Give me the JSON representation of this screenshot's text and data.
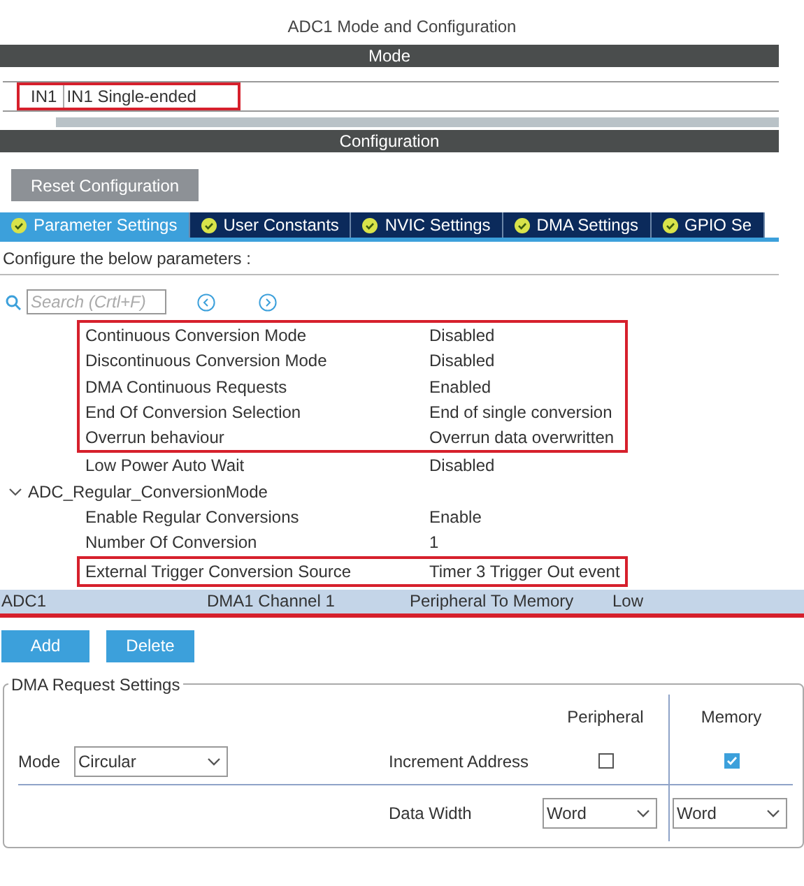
{
  "title": "ADC1 Mode and Configuration",
  "mode_header": "Mode",
  "mode": {
    "channel": "IN1",
    "value": "IN1 Single-ended",
    "highlighted": true
  },
  "config_header": "Configuration",
  "reset_button": "Reset Configuration",
  "tabs": [
    {
      "label": "Parameter Settings",
      "selected": true
    },
    {
      "label": "User Constants",
      "selected": false
    },
    {
      "label": "NVIC Settings",
      "selected": false
    },
    {
      "label": "DMA Settings",
      "selected": false
    },
    {
      "label": "GPIO Se",
      "selected": false
    }
  ],
  "hint": "Configure the below parameters :",
  "search": {
    "placeholder": "Search (Crtl+F)"
  },
  "parameters": [
    {
      "label": "Continuous Conversion Mode",
      "value": "Disabled",
      "highlighted": true
    },
    {
      "label": "Discontinuous Conversion Mode",
      "value": "Disabled",
      "highlighted": true
    },
    {
      "label": "DMA Continuous Requests",
      "value": "Enabled",
      "highlighted": true
    },
    {
      "label": "End Of Conversion Selection",
      "value": "End of single conversion",
      "highlighted": true
    },
    {
      "label": "Overrun behaviour",
      "value": "Overrun data overwritten",
      "highlighted": true
    },
    {
      "label": "Low Power Auto Wait",
      "value": "Disabled",
      "highlighted": false
    },
    {
      "label": "ADC_Regular_ConversionMode",
      "expanded": true,
      "children": [
        {
          "label": "Enable Regular Conversions",
          "value": "Enable",
          "highlighted": false
        },
        {
          "label": "Number Of Conversion",
          "value": "1",
          "highlighted": false
        },
        {
          "label": "External Trigger Conversion Source",
          "value": "Timer 3 Trigger Out event",
          "highlighted": true
        }
      ]
    }
  ],
  "dma_table": {
    "rows": [
      {
        "cells": [
          "ADC1",
          "DMA1 Channel 1",
          "Peripheral To Memory",
          "Low"
        ],
        "selected": true,
        "highlighted": true
      }
    ]
  },
  "dma_buttons": [
    "Add",
    "Delete"
  ],
  "dma_request": {
    "legend": "DMA Request Settings",
    "peripheral_header": "Peripheral",
    "memory_header": "Memory",
    "mode_label": "Mode",
    "mode_value": "Circular",
    "increment_label": "Increment Address",
    "peripheral_increment": false,
    "memory_increment": true,
    "width_label": "Data Width",
    "peripheral_width": "Word",
    "memory_width": "Word"
  }
}
